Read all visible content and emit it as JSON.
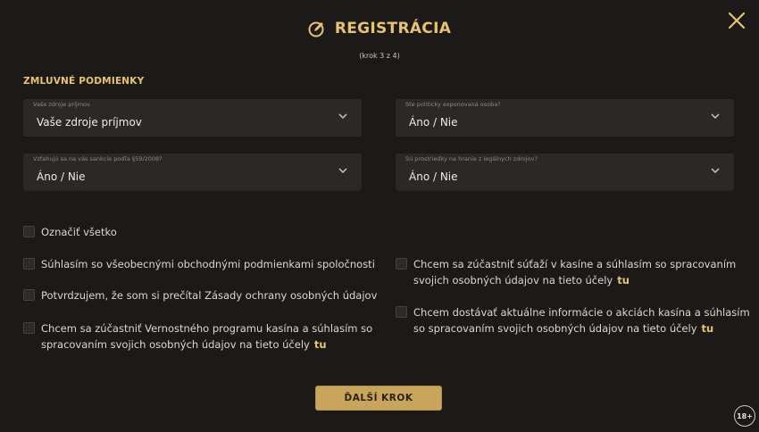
{
  "header": {
    "title": "REGISTRÁCIA",
    "step": "(krok 3 z 4)",
    "icon": "pencil-circle-icon",
    "accent": "#e8c46a"
  },
  "section": {
    "title": "ZMLUVNÉ PODMIENKY"
  },
  "selects": [
    {
      "label": "Vaše zdroje príjmov",
      "value": "Vaše zdroje príjmov"
    },
    {
      "label": "Ste politicky exponovaná osoba?",
      "value": "Áno / Nie"
    },
    {
      "label": "Vzťahujú sa na vás sankcie podľa §59/2008?",
      "value": "Áno / Nie"
    },
    {
      "label": "Sú prostriedky na hranie z legálnych zdrojov?",
      "value": "Áno / Nie"
    }
  ],
  "checkboxes": {
    "select_all": "Označiť všetko",
    "left": [
      {
        "text": "Súhlasím so všeobecnými obchodnými podmienkami spoločnosti"
      },
      {
        "text": "Potvrdzujem, že som si prečítal Zásady ochrany osobných údajov"
      },
      {
        "line1": "Chcem sa zúčastniť Vernostného programu kasína a súhlasím so",
        "line2": "spracovaním svojich osobných údajov na tieto účely",
        "link": "tu"
      }
    ],
    "right": [
      {
        "line1": "Chcem sa zúčastniť súťaží v kasíne a súhlasím so spracovaním",
        "line2": "svojich osobných údajov na tieto účely",
        "link": "tu"
      },
      {
        "line1": "Chcem dostávať aktuálne informácie o akciách kasína a súhlasím",
        "line2": "so spracovaním svojich osobných údajov na tieto účely",
        "link": "tu"
      }
    ]
  },
  "buttons": {
    "next": "ĎALŠÍ KROK"
  },
  "badge": {
    "age": "18+"
  }
}
